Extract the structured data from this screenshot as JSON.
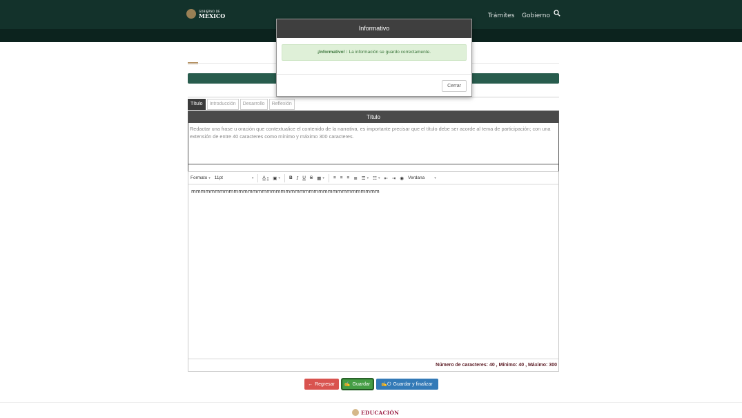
{
  "header": {
    "logo_small": "GOBIERNO DE",
    "logo_big": "MÉXICO",
    "nav": [
      "Trámites",
      "Gobierno"
    ],
    "search_icon": "search-icon",
    "cerrar_label": "Cerrar"
  },
  "tabs": [
    {
      "label": "Título",
      "active": true
    },
    {
      "label": "Introducción",
      "active": false
    },
    {
      "label": "Desarrollo",
      "active": false
    },
    {
      "label": "Reflexión",
      "active": false
    }
  ],
  "panel": {
    "title": "Título",
    "instructions": "Redactar una frase u oración que contextualice el contenido de la narrativa, es importante precisar que el título debe ser acorde al tema de participación; con una extensión de entre 40 caracteres como mínimo y máximo 300 caracteres."
  },
  "editor": {
    "toolbar": {
      "format_label": "Formato",
      "size_label": "11pt",
      "font_label": "Verdana"
    },
    "content": "mmmmmmmmmmmmmmmmmmmmmmmmmmmmmmmmmmmmmmmm",
    "counter": "Número de caracteres: 40 , Mínimo: 40 , Máximo: 300"
  },
  "actions": {
    "back_label": "Regresar",
    "save_label": "Guardar",
    "finish_label": "Guardar y finalizar"
  },
  "footer": {
    "brand": "EDUCACIÓN"
  },
  "modal": {
    "title": "Informativo",
    "alert_bold": "¡Informativo! :",
    "alert_text": " La información se guardo correctamente.",
    "close_label": "Cerrar"
  },
  "colors": {
    "topbar": "#13322b",
    "band": "#285c4d",
    "accent_gold": "#b38e5d",
    "danger": "#d9534f",
    "success": "#449d44",
    "primary": "#337ab7"
  }
}
